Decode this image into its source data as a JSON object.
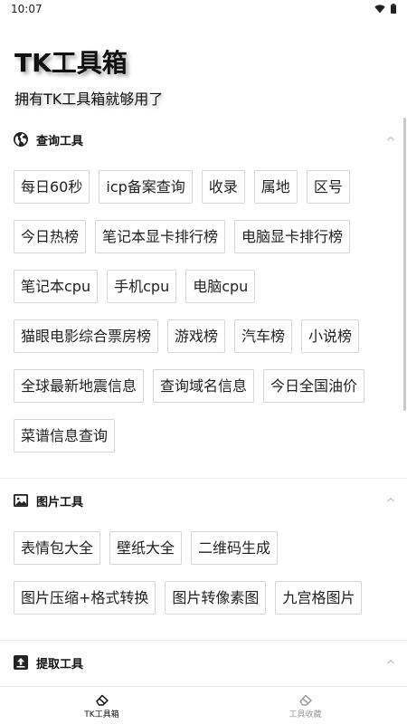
{
  "status_bar": {
    "time": "10:07"
  },
  "header": {
    "title": "TK工具箱",
    "subtitle": "拥有TK工具箱就够用了"
  },
  "sections": [
    {
      "title": "查询工具",
      "icon": "globe-icon",
      "tools": [
        "每日60秒",
        "icp备案查询",
        "收录",
        "属地",
        "区号",
        "今日热榜",
        "笔记本显卡排行榜",
        "电脑显卡排行榜",
        "笔记本cpu",
        "手机cpu",
        "电脑cpu",
        "猫眼电影综合票房榜",
        "游戏榜",
        "汽车榜",
        "小说榜",
        "全球最新地震信息",
        "查询域名信息",
        "今日全国油价",
        "菜谱信息查询"
      ]
    },
    {
      "title": "图片工具",
      "icon": "image-icon",
      "tools": [
        "表情包大全",
        "壁纸大全",
        "二维码生成",
        "图片压缩+格式转换",
        "图片转像素图",
        "九宫格图片"
      ]
    },
    {
      "title": "提取工具",
      "icon": "upload-icon",
      "tools": []
    }
  ],
  "bottom_nav": [
    {
      "label": "TK工具箱",
      "icon": "eraser-icon",
      "active": true
    },
    {
      "label": "工具收藏",
      "icon": "eraser-icon",
      "active": false
    }
  ],
  "colors": {
    "text": "#111111",
    "chip_border": "#d6d6d6",
    "inactive": "#9a9a9a"
  }
}
